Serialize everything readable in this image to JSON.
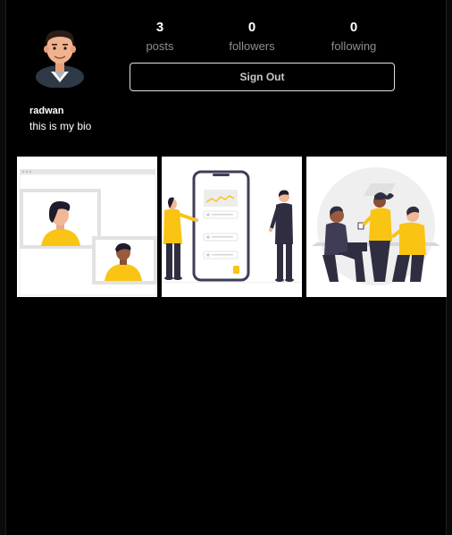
{
  "profile": {
    "username": "radwan",
    "bio": "this is my bio"
  },
  "stats": {
    "posts": {
      "value": "3",
      "label": "posts"
    },
    "followers": {
      "value": "0",
      "label": "followers"
    },
    "following": {
      "value": "0",
      "label": "following"
    }
  },
  "actions": {
    "sign_out_label": "Sign Out"
  },
  "posts": [
    {
      "illustration": "video-call-illustration"
    },
    {
      "illustration": "mobile-app-illustration"
    },
    {
      "illustration": "team-meeting-illustration"
    }
  ],
  "colors": {
    "background": "#000000",
    "accent_yellow": "#F9C413",
    "muted_text": "#8E8E8E"
  }
}
